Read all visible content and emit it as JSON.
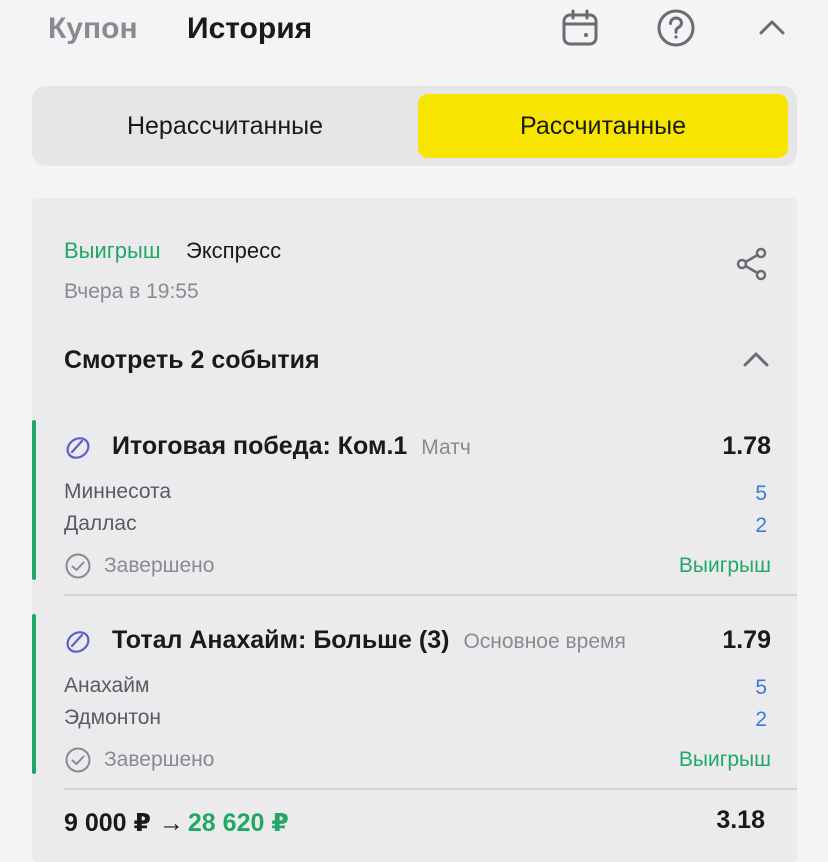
{
  "header": {
    "tab_coupon": "Купон",
    "tab_history": "История"
  },
  "segment": {
    "unsettled": "Нерассчитанные",
    "settled": "Рассчитанные",
    "active_color": "#f7e500"
  },
  "bet": {
    "status": "Выигрыш",
    "type": "Экспресс",
    "time": "Вчера в 19:55",
    "events_toggle": "Смотреть 2 события",
    "events": [
      {
        "market": "Итоговая победа: Ком.1",
        "period": "Матч",
        "odds": "1.78",
        "team1": "Миннесота",
        "team2": "Даллас",
        "score1": "5",
        "score2": "2",
        "status": "Завершено",
        "result": "Выигрыш"
      },
      {
        "market": "Тотал Анахайм: Больше (3)",
        "period": "Основное время",
        "odds": "1.79",
        "team1": "Анахайм",
        "team2": "Эдмонтон",
        "score1": "5",
        "score2": "2",
        "status": "Завершено",
        "result": "Выигрыш"
      }
    ],
    "stake": "9 000 ₽",
    "arrow": "→",
    "payout": "28 620 ₽",
    "total_odds": "3.18"
  },
  "colors": {
    "win": "#22a866",
    "score": "#3a7bd5",
    "accent_yellow": "#f7e500"
  },
  "icons": [
    "calendar-icon",
    "help-icon",
    "chevron-up-icon",
    "share-icon",
    "hockey-puck-icon",
    "check-circle-icon"
  ]
}
